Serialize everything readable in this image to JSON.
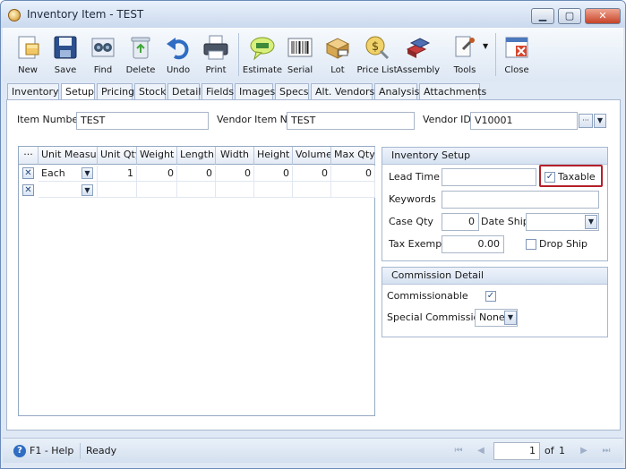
{
  "window": {
    "title": "Inventory Item - TEST",
    "minimize": "▁",
    "maximize": "▢",
    "close": "✕"
  },
  "toolbar": {
    "buttons": [
      {
        "label": "New",
        "icon": "new-icon"
      },
      {
        "label": "Save",
        "icon": "save-icon"
      },
      {
        "label": "Find",
        "icon": "find-icon"
      },
      {
        "label": "Delete",
        "icon": "delete-icon"
      },
      {
        "label": "Undo",
        "icon": "undo-icon"
      },
      {
        "label": "Print",
        "icon": "print-icon"
      },
      {
        "label": "Estimate",
        "icon": "estimate-icon"
      },
      {
        "label": "Serial",
        "icon": "serial-icon"
      },
      {
        "label": "Lot",
        "icon": "lot-icon"
      },
      {
        "label": "Price List",
        "icon": "price-list-icon"
      },
      {
        "label": "Assembly",
        "icon": "assembly-icon"
      },
      {
        "label": "Tools",
        "icon": "tools-icon"
      },
      {
        "label": "Close",
        "icon": "close-icon"
      }
    ]
  },
  "tabs": [
    "Inventory",
    "Setup",
    "Pricing",
    "Stock",
    "Detail",
    "Fields",
    "Images",
    "Specs",
    "Alt. Vendors",
    "Analysis",
    "Attachments"
  ],
  "active_tab": "Setup",
  "header": {
    "item_number_label": "Item Number",
    "item_number_value": "TEST",
    "vendor_item_no_label": "Vendor Item No",
    "vendor_item_no_value": "TEST",
    "vendor_id_label": "Vendor ID",
    "vendor_id_value": "V10001",
    "ellipsis": "···"
  },
  "grid": {
    "ellipsis": "···",
    "columns": [
      "Unit Measure",
      "Unit Qty",
      "Weight",
      "Length",
      "Width",
      "Height",
      "Volume",
      "Max Qty"
    ],
    "rows": [
      {
        "unit_measure": "Each",
        "unit_qty": "1",
        "weight": "0",
        "length": "0",
        "width": "0",
        "height": "0",
        "volume": "0",
        "max_qty": "0"
      }
    ]
  },
  "inventory_setup": {
    "title": "Inventory Setup",
    "lead_time_label": "Lead Time",
    "lead_time_value": "",
    "taxable_label": "Taxable",
    "taxable_checked": true,
    "keywords_label": "Keywords",
    "keywords_value": "",
    "case_qty_label": "Case Qty",
    "case_qty_value": "0",
    "date_ship_label": "Date Ship",
    "date_ship_value": "",
    "tax_exempt_label": "Tax Exempt",
    "tax_exempt_value": "0.00",
    "drop_ship_label": "Drop Ship",
    "drop_ship_checked": false
  },
  "commission": {
    "title": "Commission Detail",
    "commissionable_label": "Commissionable",
    "commissionable_checked": true,
    "special_commission_label": "Special Commission",
    "special_commission_value": "None"
  },
  "status": {
    "help": "F1 - Help",
    "state": "Ready",
    "page": "1",
    "of_label": "of",
    "total_pages": "1"
  },
  "colors": {
    "highlight": "#b3202a",
    "accent": "#2f6cc2"
  }
}
